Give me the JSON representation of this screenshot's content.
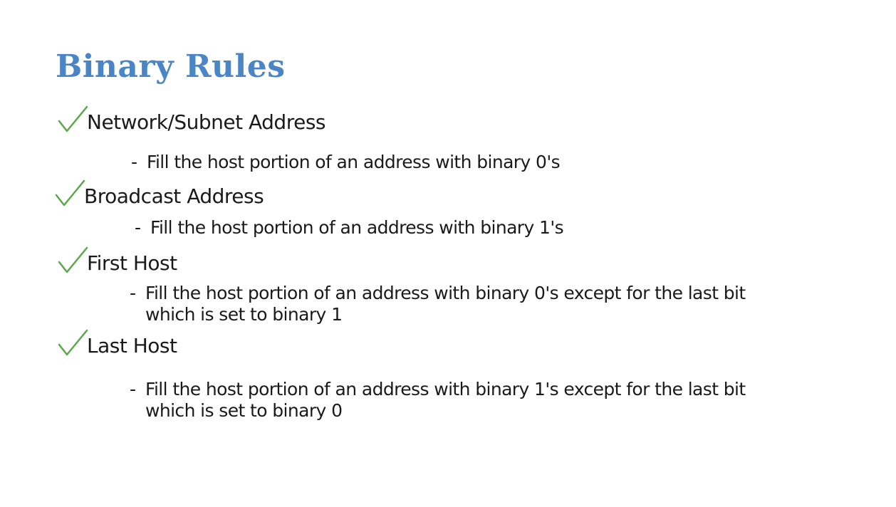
{
  "title": "Binary Rules",
  "colors": {
    "title": "#4a86c5",
    "check": "#5aa84a",
    "text": "#1a1a1a"
  },
  "sections": [
    {
      "icon": "checkmark-icon",
      "heading": "Network/Subnet Address",
      "dash": "-",
      "rule": "Fill the host portion of an address with binary 0's"
    },
    {
      "icon": "checkmark-icon",
      "heading": "Broadcast Address",
      "dash": "-",
      "rule": "Fill the host portion of an address with binary 1's"
    },
    {
      "icon": "checkmark-icon",
      "heading": "First Host",
      "dash": "-",
      "rule": "Fill the host portion of an address with binary 0's except for the last bit\nwhich is set to binary 1"
    },
    {
      "icon": "checkmark-icon",
      "heading": "Last Host",
      "dash": "-",
      "rule": "Fill the host portion of an address with binary 1's except for the last bit\nwhich is set to binary 0"
    }
  ]
}
